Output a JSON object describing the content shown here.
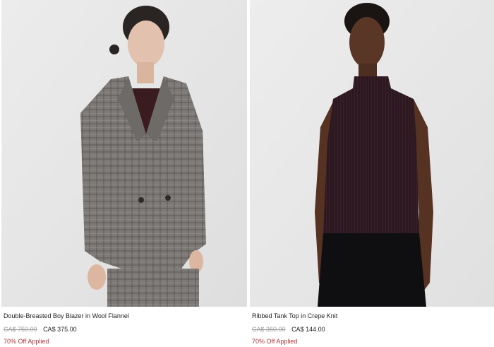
{
  "products": [
    {
      "image_alt": "",
      "name": "Double-Breasted Boy Blazer in Wool Flannel",
      "original_price": "CA$ 750.00",
      "sale_price": "CA$ 375.00",
      "promo": "70% Off Applied"
    },
    {
      "image_alt": "",
      "name": "Ribbed Tank Top in Crepe Knit",
      "original_price": "CA$ 360.00",
      "sale_price": "CA$ 144.00",
      "promo": "70% Off Applied"
    }
  ],
  "colors": {
    "promo": "#b0363a",
    "strike": "#999999"
  }
}
